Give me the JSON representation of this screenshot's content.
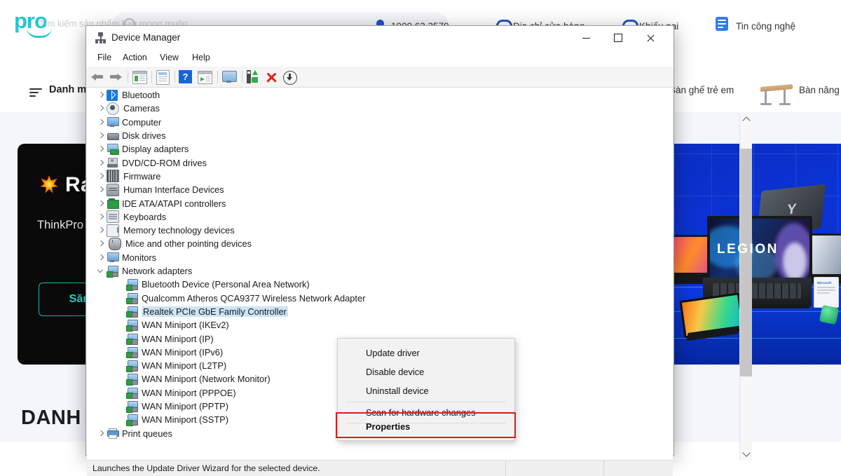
{
  "background_site": {
    "logo_text": "pro",
    "search_placeholder": "Tìm kiếm sản phẩm bạn mong muốn...",
    "header_links": [
      {
        "label": "1900 63 3579",
        "icon": "location-pin-icon"
      },
      {
        "label": "Địa chỉ cửa hàng",
        "icon": "store-arch-icon"
      },
      {
        "label": "Khiếu nại",
        "icon": "support-arch-icon"
      },
      {
        "label": "Tin công nghệ",
        "icon": "news-icon"
      }
    ],
    "nav": {
      "menu_label": "Danh mục sản phẩm",
      "items": [
        {
          "label": "Bàn ghế trẻ em"
        },
        {
          "label": "Bàn nâng hạ"
        }
      ]
    },
    "promo_card": {
      "title": "Ra mắt",
      "body": "ThinkPro là nơi giúp bạn tìm thấy công nghệ chất lượng",
      "button_label": "Săn ưu đãi"
    },
    "section_heading": "DANH MỤC",
    "banner": {
      "brand_text": "LEGION"
    }
  },
  "device_manager": {
    "window_title": "Device Manager",
    "window_controls": {
      "minimize": "minimize-button",
      "maximize": "maximize-button",
      "close": "close-button"
    },
    "menu": [
      "File",
      "Action",
      "View",
      "Help"
    ],
    "toolbar_icons": [
      "back-arrow-icon",
      "forward-arrow-icon",
      "show-hidden-devices-icon",
      "properties-document-icon",
      "help-icon",
      "view-devices-icon",
      "update-driver-monitor-icon",
      "scan-hardware-icon",
      "uninstall-device-icon",
      "download-driver-icon"
    ],
    "tree": [
      {
        "label": "Bluetooth",
        "icon": "bluetooth-icon",
        "indent": 0,
        "expanded": false,
        "selected": false
      },
      {
        "label": "Cameras",
        "icon": "camera-icon",
        "indent": 0,
        "expanded": false,
        "selected": false
      },
      {
        "label": "Computer",
        "icon": "computer-icon",
        "indent": 0,
        "expanded": false,
        "selected": false
      },
      {
        "label": "Disk drives",
        "icon": "disk-drive-icon",
        "indent": 0,
        "expanded": false,
        "selected": false
      },
      {
        "label": "Display adapters",
        "icon": "display-adapter-icon",
        "indent": 0,
        "expanded": false,
        "selected": false
      },
      {
        "label": "DVD/CD-ROM drives",
        "icon": "dvd-drive-icon",
        "indent": 0,
        "expanded": false,
        "selected": false
      },
      {
        "label": "Firmware",
        "icon": "firmware-icon",
        "indent": 0,
        "expanded": false,
        "selected": false
      },
      {
        "label": "Human Interface Devices",
        "icon": "hid-icon",
        "indent": 0,
        "expanded": false,
        "selected": false
      },
      {
        "label": "IDE ATA/ATAPI controllers",
        "icon": "ide-controller-icon",
        "indent": 0,
        "expanded": false,
        "selected": false
      },
      {
        "label": "Keyboards",
        "icon": "keyboard-icon",
        "indent": 0,
        "expanded": false,
        "selected": false
      },
      {
        "label": "Memory technology devices",
        "icon": "memory-device-icon",
        "indent": 0,
        "expanded": false,
        "selected": false
      },
      {
        "label": "Mice and other pointing devices",
        "icon": "mouse-icon",
        "indent": 0,
        "expanded": false,
        "selected": false
      },
      {
        "label": "Monitors",
        "icon": "monitor-icon",
        "indent": 0,
        "expanded": false,
        "selected": false
      },
      {
        "label": "Network adapters",
        "icon": "network-adapter-icon",
        "indent": 0,
        "expanded": true,
        "selected": false
      },
      {
        "label": "Bluetooth Device (Personal Area Network)",
        "icon": "network-adapter-icon",
        "indent": 1,
        "expanded": null,
        "selected": false
      },
      {
        "label": "Qualcomm Atheros QCA9377 Wireless Network Adapter",
        "icon": "network-adapter-icon",
        "indent": 1,
        "expanded": null,
        "selected": false
      },
      {
        "label": "Realtek PCIe GbE Family Controller",
        "icon": "network-adapter-icon",
        "indent": 1,
        "expanded": null,
        "selected": true
      },
      {
        "label": "WAN Miniport (IKEv2)",
        "icon": "network-adapter-icon",
        "indent": 1,
        "expanded": null,
        "selected": false
      },
      {
        "label": "WAN Miniport (IP)",
        "icon": "network-adapter-icon",
        "indent": 1,
        "expanded": null,
        "selected": false
      },
      {
        "label": "WAN Miniport (IPv6)",
        "icon": "network-adapter-icon",
        "indent": 1,
        "expanded": null,
        "selected": false
      },
      {
        "label": "WAN Miniport (L2TP)",
        "icon": "network-adapter-icon",
        "indent": 1,
        "expanded": null,
        "selected": false
      },
      {
        "label": "WAN Miniport (Network Monitor)",
        "icon": "network-adapter-icon",
        "indent": 1,
        "expanded": null,
        "selected": false
      },
      {
        "label": "WAN Miniport (PPPOE)",
        "icon": "network-adapter-icon",
        "indent": 1,
        "expanded": null,
        "selected": false
      },
      {
        "label": "WAN Miniport (PPTP)",
        "icon": "network-adapter-icon",
        "indent": 1,
        "expanded": null,
        "selected": false
      },
      {
        "label": "WAN Miniport (SSTP)",
        "icon": "network-adapter-icon",
        "indent": 1,
        "expanded": null,
        "selected": false
      },
      {
        "label": "Print queues",
        "icon": "printer-icon",
        "indent": 0,
        "expanded": false,
        "selected": false
      }
    ],
    "context_menu": {
      "items": [
        {
          "label": "Update driver",
          "bold": false,
          "highlighted": false
        },
        {
          "label": "Disable device",
          "bold": false,
          "highlighted": false
        },
        {
          "label": "Uninstall device",
          "bold": false,
          "highlighted": false
        },
        {
          "label": "Scan for hardware changes",
          "bold": false,
          "highlighted": false
        },
        {
          "label": "Properties",
          "bold": true,
          "highlighted": true
        }
      ],
      "highlight_color": "#d02020"
    },
    "status_bar": {
      "text": "Launches the Update Driver Wizard for the selected device."
    }
  },
  "colors": {
    "selection_blue": "#cce4f7",
    "accent_cyan": "#22c7d6",
    "banner_blue": "#0b33d6",
    "highlight_red": "#d02020"
  }
}
